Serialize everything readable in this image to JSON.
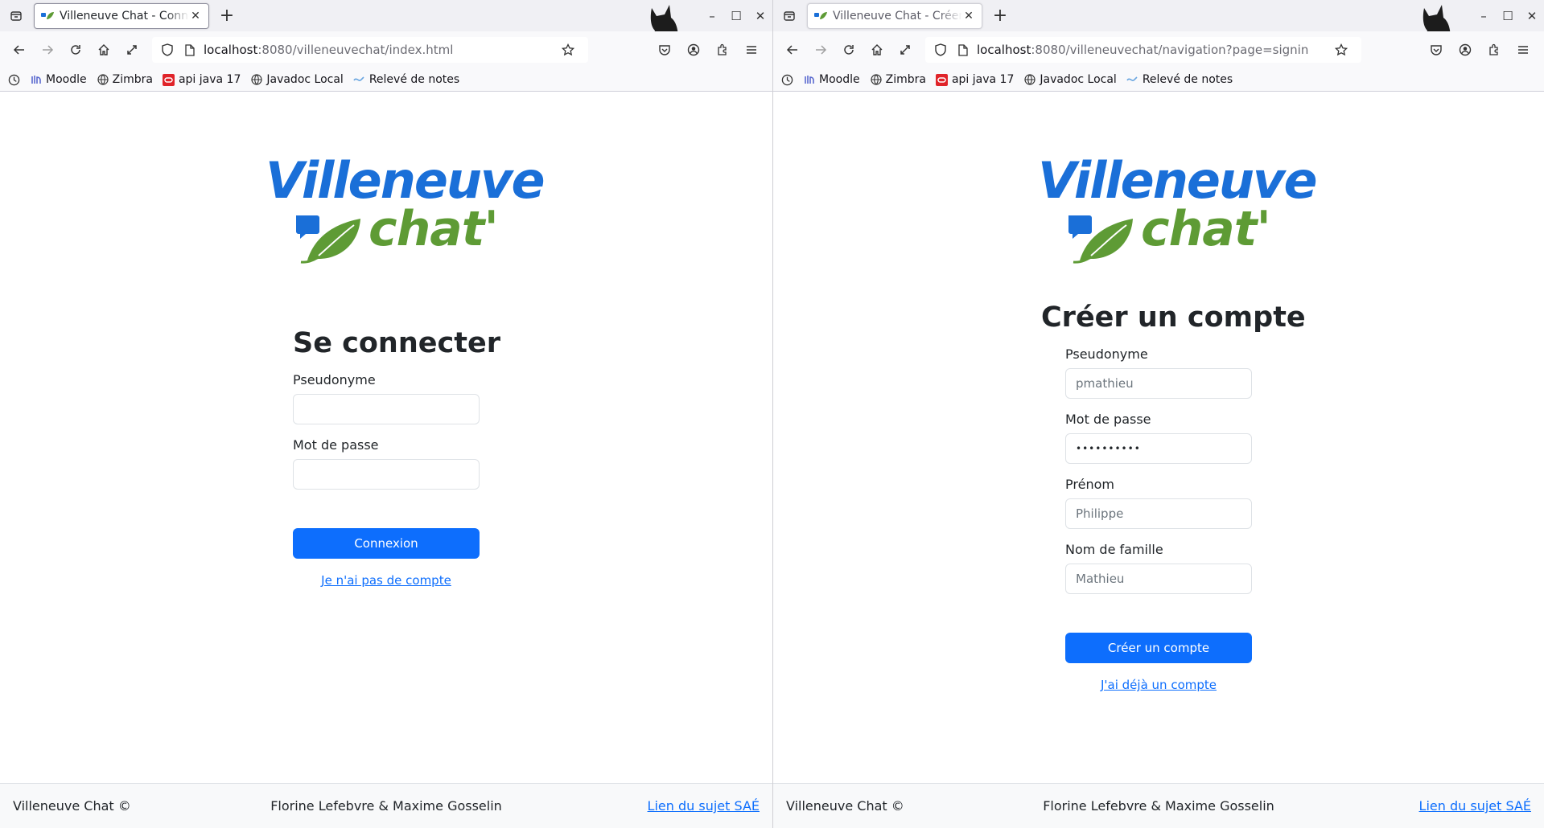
{
  "left": {
    "tab_title": "Villeneuve Chat - Connexion",
    "url_host": "localhost",
    "url_rest": ":8080/villeneuvechat/index.html",
    "heading": "Se connecter",
    "fields": [
      {
        "label": "Pseudonyme",
        "value": ""
      },
      {
        "label": "Mot de passe",
        "value": ""
      }
    ],
    "submit_label": "Connexion",
    "alt_link": "Je n'ai pas de compte"
  },
  "right": {
    "tab_title": "Villeneuve Chat - Créer un compte",
    "url_host": "localhost",
    "url_rest": ":8080/villeneuvechat/navigation?page=signin",
    "heading": "Créer un compte",
    "fields": [
      {
        "label": "Pseudonyme",
        "value": "pmathieu"
      },
      {
        "label": "Mot de passe",
        "value": "••••••••••"
      },
      {
        "label": "Prénom",
        "value": "Philippe"
      },
      {
        "label": "Nom de famille",
        "value": "Mathieu"
      }
    ],
    "submit_label": "Créer un compte",
    "alt_link": "J'ai déjà un compte"
  },
  "bookmarks": [
    "Moodle",
    "Zimbra",
    "api java 17",
    "Javadoc Local",
    "Relevé de notes"
  ],
  "logo": {
    "line1": "Villeneuve",
    "line2": "chat'"
  },
  "footer": {
    "brand": "Villeneuve Chat ©",
    "authors": "Florine Lefebvre & Maxime Gosselin",
    "link": "Lien du sujet SAÉ"
  },
  "colors": {
    "primary": "#0d6efd",
    "logo_blue": "#1a6fd8",
    "logo_green": "#5e9b35"
  }
}
